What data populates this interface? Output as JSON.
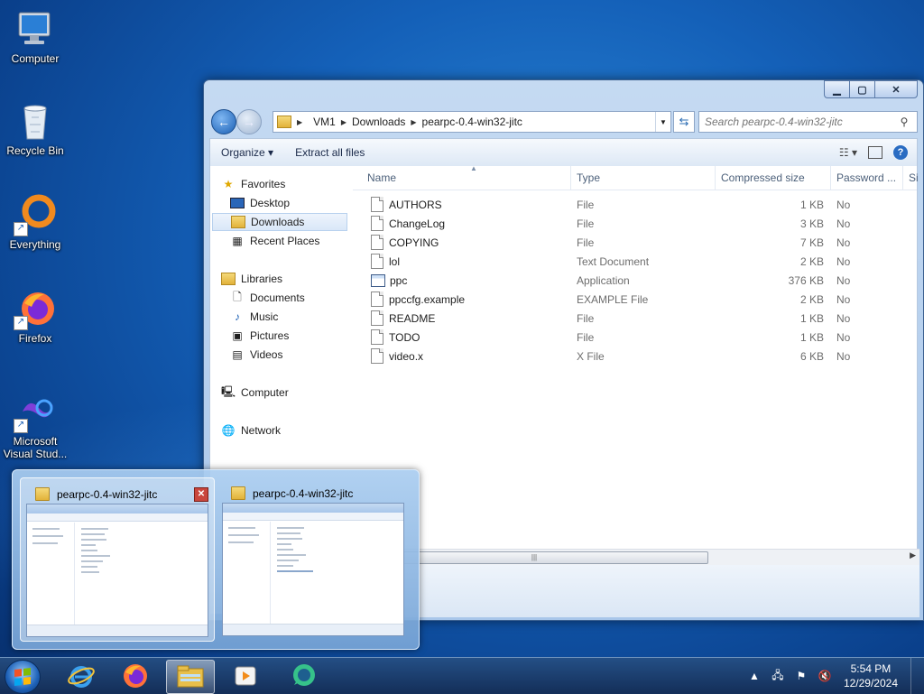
{
  "desktop": {
    "icons": [
      {
        "label": "Computer"
      },
      {
        "label": "Recycle Bin"
      },
      {
        "label": "Everything"
      },
      {
        "label": "Firefox"
      },
      {
        "label": "Microsoft Visual Stud..."
      }
    ]
  },
  "window": {
    "address": {
      "segments": [
        "VM1",
        "Downloads",
        "pearpc-0.4-win32-jitc"
      ]
    },
    "search": {
      "placeholder": "Search pearpc-0.4-win32-jitc"
    },
    "toolbar": {
      "organize": "Organize",
      "extract": "Extract all files"
    },
    "nav": {
      "favorites": "Favorites",
      "desktop": "Desktop",
      "downloads": "Downloads",
      "recent": "Recent Places",
      "libraries": "Libraries",
      "documents": "Documents",
      "music": "Music",
      "pictures": "Pictures",
      "videos": "Videos",
      "computer": "Computer",
      "network": "Network"
    },
    "columns": {
      "name": "Name",
      "type": "Type",
      "compressed": "Compressed size",
      "password": "Password ...",
      "size": "Si"
    },
    "files": [
      {
        "name": "AUTHORS",
        "type": "File",
        "size": "1 KB",
        "password": "No"
      },
      {
        "name": "ChangeLog",
        "type": "File",
        "size": "3 KB",
        "password": "No"
      },
      {
        "name": "COPYING",
        "type": "File",
        "size": "7 KB",
        "password": "No"
      },
      {
        "name": "lol",
        "type": "Text Document",
        "size": "2 KB",
        "password": "No"
      },
      {
        "name": "ppc",
        "type": "Application",
        "size": "376 KB",
        "password": "No"
      },
      {
        "name": "ppccfg.example",
        "type": "EXAMPLE File",
        "size": "2 KB",
        "password": "No"
      },
      {
        "name": "README",
        "type": "File",
        "size": "1 KB",
        "password": "No"
      },
      {
        "name": "TODO",
        "type": "File",
        "size": "1 KB",
        "password": "No"
      },
      {
        "name": "video.x",
        "type": "X File",
        "size": "6 KB",
        "password": "No"
      }
    ]
  },
  "thumbnails": [
    {
      "title": "pearpc-0.4-win32-jitc"
    },
    {
      "title": "pearpc-0.4-win32-jitc"
    }
  ],
  "tray": {
    "time": "5:54 PM",
    "date": "12/29/2024"
  },
  "colors": {
    "accent": "#1a5fb4",
    "taskbar": "#1c3a66"
  }
}
